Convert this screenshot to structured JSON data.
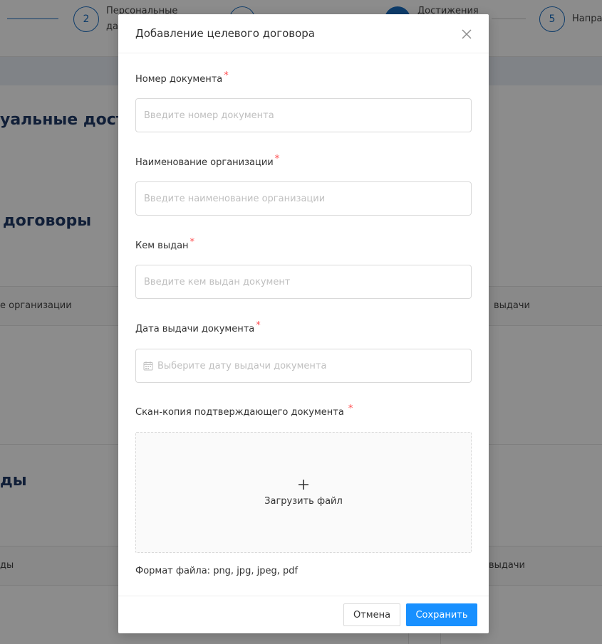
{
  "background": {
    "steps": [
      {
        "number": "2",
        "label": "Персональные да"
      },
      {
        "number": "",
        "label": ""
      },
      {
        "number": "",
        "label": "Достижения"
      },
      {
        "number": "5",
        "label": "Направ"
      }
    ],
    "headings": [
      "уальные дости",
      "договоры",
      "ды"
    ],
    "table1_headers": [
      "е организации",
      "выдачи"
    ],
    "table2_headers": [
      "ды",
      "выдачи"
    ]
  },
  "modal": {
    "title": "Добавление целевого договора",
    "close_symbol": "×",
    "fields": {
      "doc_number": {
        "label": "Номер документа",
        "placeholder": "Введите номер документа",
        "value": ""
      },
      "org_name": {
        "label": "Наименование организации",
        "placeholder": "Введите наименование организации",
        "value": ""
      },
      "issued_by": {
        "label": "Кем выдан",
        "placeholder": "Введите кем выдан документ",
        "value": ""
      },
      "issue_date": {
        "label": "Дата выдачи документа",
        "placeholder": "Выберите дату выдачи документа"
      },
      "scan_copy": {
        "label": "Скан-копия подтверждающего документа"
      }
    },
    "required_mark": "*",
    "upload": {
      "plus": "+",
      "text": "Загрузить файл"
    },
    "format_note": "Формат файла: png, jpg, jpeg, pdf",
    "buttons": {
      "cancel": "Отмена",
      "save": "Сохранить"
    }
  },
  "colors": {
    "primary": "#1890ff",
    "required": "#ff4d4f",
    "step_blue": "#1b6ec2",
    "heading": "#1f3a66"
  }
}
